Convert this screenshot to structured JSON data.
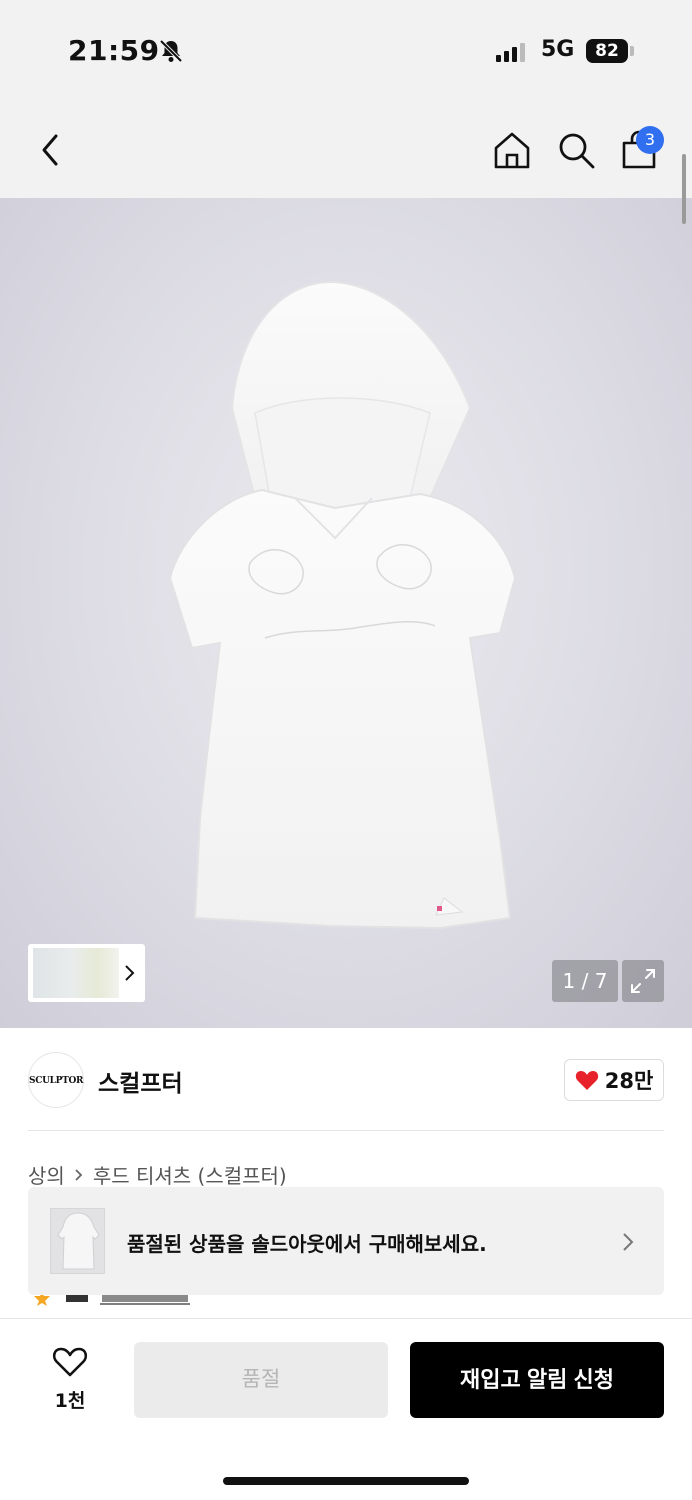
{
  "status_bar": {
    "time": "21:59",
    "network": "5G",
    "battery": "82",
    "icons": [
      "bell-off-icon",
      "signal-icon",
      "battery-icon"
    ]
  },
  "nav": {
    "icons": [
      "chevron-left-icon",
      "home-icon",
      "search-icon",
      "shopping-bag-icon"
    ],
    "cart_count": "3"
  },
  "gallery": {
    "counter": "1 / 7",
    "expand_icon": "expand-icon",
    "thumbnail_arrow_icon": "chevron-right-icon",
    "background_color": "#dddce4"
  },
  "brand": {
    "logo_text": "SCULPTOR",
    "name": "스컬프터",
    "like_count": "28만",
    "like_color": "#e8222a"
  },
  "breadcrumb": {
    "category": "상의",
    "product": "후드 티셔츠 (스컬프터)"
  },
  "soldout_banner": {
    "text": "품절된 상품을 솔드아웃에서 구매해보세요."
  },
  "bottom_bar": {
    "wish_count": "1천",
    "soldout_label": "품절",
    "restock_label": "재입고 알림 신청"
  },
  "colors": {
    "accent_badge": "#2f6ff0",
    "primary_button": "#000000",
    "disabled_button": "#ebebeb"
  }
}
